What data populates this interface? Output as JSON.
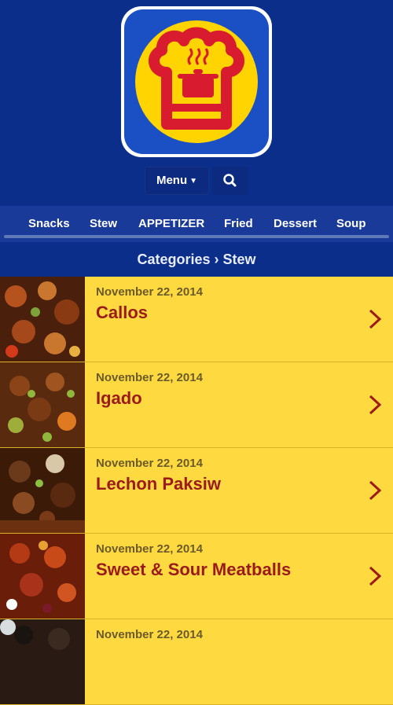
{
  "header": {
    "logo_icon": "chef-hat-pot-icon",
    "menu_label": "Menu",
    "search_icon": "search-icon"
  },
  "nav": {
    "items": [
      {
        "label": "Snacks"
      },
      {
        "label": "Stew"
      },
      {
        "label": "APPETIZER"
      },
      {
        "label": "Fried"
      },
      {
        "label": "Dessert"
      },
      {
        "label": "Soup"
      }
    ]
  },
  "breadcrumb": "Categories › Stew",
  "posts": [
    {
      "date": "November 22, 2014",
      "title": "Callos"
    },
    {
      "date": "November 22, 2014",
      "title": "Igado"
    },
    {
      "date": "November 22, 2014",
      "title": "Lechon Paksiw"
    },
    {
      "date": "November 22, 2014",
      "title": "Sweet & Sour Meatballs"
    },
    {
      "date": "November 22, 2014",
      "title": ""
    }
  ],
  "colors": {
    "header_bg": "#0a2e8a",
    "nav_bg": "#1a3a99",
    "item_bg": "#ffd940",
    "title": "#9b1a1a",
    "logo_yellow": "#ffd400",
    "logo_red": "#d81b2f"
  }
}
